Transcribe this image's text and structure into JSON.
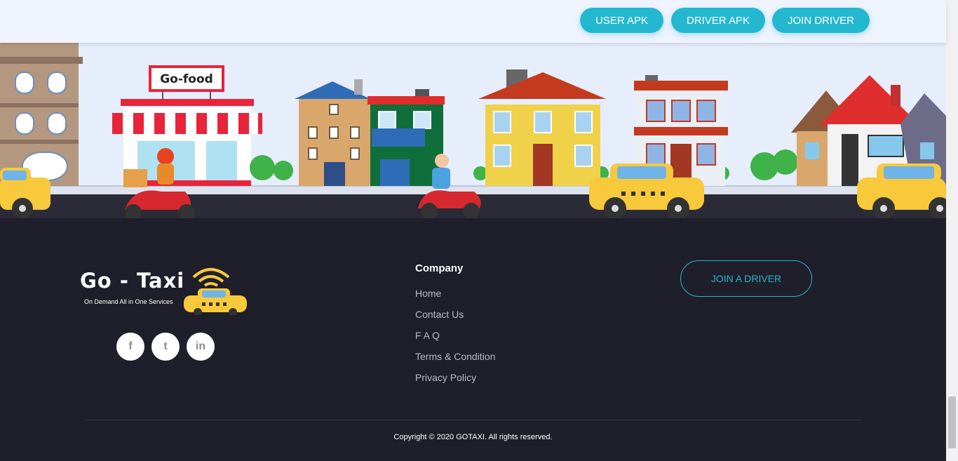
{
  "header": {
    "buttons": [
      {
        "label": "USER APK"
      },
      {
        "label": "DRIVER APK"
      },
      {
        "label": "JOIN DRIVER"
      }
    ]
  },
  "scene": {
    "shop_sign": "Go-food"
  },
  "footer": {
    "logo": {
      "name": "Go - Taxi",
      "tagline": "On Demand All in One Services"
    },
    "social": [
      {
        "icon": "facebook-icon",
        "glyph": "f"
      },
      {
        "icon": "twitter-icon",
        "glyph": "t"
      },
      {
        "icon": "linkedin-icon",
        "glyph": "in"
      }
    ],
    "company": {
      "heading": "Company",
      "links": [
        "Home",
        "Contact Us",
        "F A Q",
        "Terms & Condition",
        "Privacy Policy"
      ]
    },
    "join_button": "JOIN A DRIVER",
    "copyright": "Copyright © 2020 GOTAXI. All rights reserved."
  },
  "colors": {
    "accent": "#23b8d0",
    "footer_bg": "#1f1f2b",
    "taxi": "#f7c93b"
  }
}
